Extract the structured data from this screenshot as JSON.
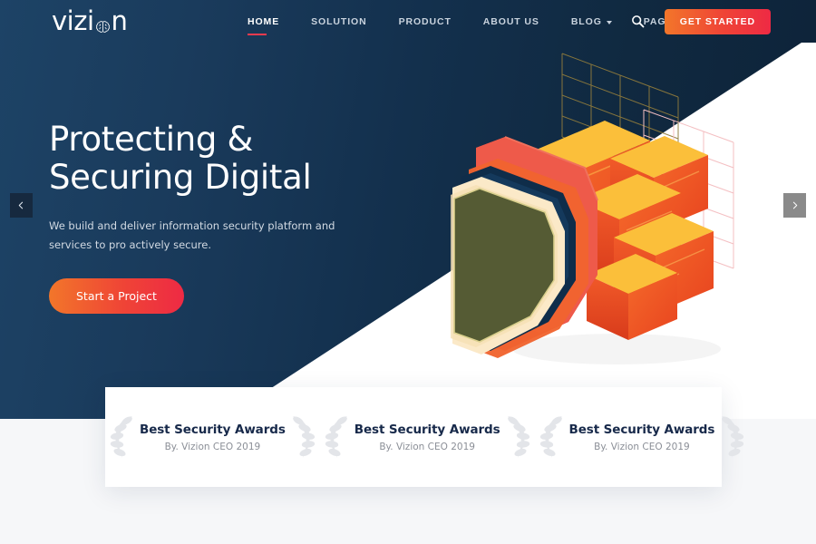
{
  "brand": {
    "name": "vizion",
    "logo_icon": "brain-icon",
    "accent_orange": "#f2762a",
    "accent_red": "#ee2a44",
    "navy": "#13304d"
  },
  "nav": {
    "items": [
      {
        "label": "HOME",
        "active": true,
        "has_dropdown": false
      },
      {
        "label": "SOLUTION",
        "active": false,
        "has_dropdown": false
      },
      {
        "label": "PRODUCT",
        "active": false,
        "has_dropdown": false
      },
      {
        "label": "ABOUT US",
        "active": false,
        "has_dropdown": false
      },
      {
        "label": "BLOG",
        "active": false,
        "has_dropdown": true
      },
      {
        "label": "PAGES",
        "active": false,
        "has_dropdown": true
      }
    ],
    "search_icon": "search-icon",
    "cta_label": "GET STARTED"
  },
  "hero": {
    "title": "Protecting &\nSecuring Digital",
    "subtitle": "We build and deliver information security platform and services to pro actively secure.",
    "cta_label": "Start a Project",
    "prev_label": "‹",
    "next_label": "›"
  },
  "awards": [
    {
      "title": "Best Security Awards",
      "subtitle": "By. Vizion CEO 2019"
    },
    {
      "title": "Best Security Awards",
      "subtitle": "By. Vizion CEO 2019"
    },
    {
      "title": "Best Security Awards",
      "subtitle": "By. Vizion CEO 2019"
    }
  ]
}
